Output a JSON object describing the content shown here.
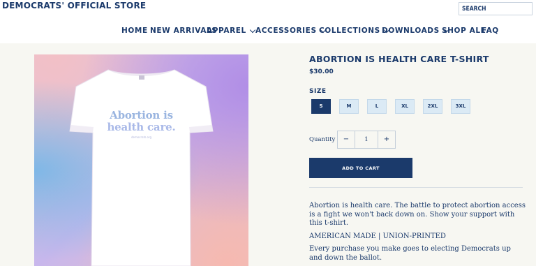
{
  "header": {
    "store_title": "DEMOCRATS' OFFICIAL STORE",
    "search_placeholder": "SEARCH"
  },
  "nav": {
    "items": [
      {
        "label": "HOME",
        "has_dropdown": false
      },
      {
        "label": "NEW ARRIVALS",
        "has_dropdown": false
      },
      {
        "label": "APPAREL",
        "has_dropdown": true
      },
      {
        "label": "ACCESSORIES",
        "has_dropdown": true
      },
      {
        "label": "COLLECTIONS",
        "has_dropdown": true
      },
      {
        "label": "DOWNLOADS",
        "has_dropdown": true
      },
      {
        "label": "SHOP ALL",
        "has_dropdown": false
      },
      {
        "label": "FAQ",
        "has_dropdown": false
      }
    ]
  },
  "product": {
    "image": {
      "shirt_line1": "Abortion is",
      "shirt_line2": "health care.",
      "shirt_url": "democrats.org"
    },
    "title": "ABORTION IS HEALTH CARE T-SHIRT",
    "price": "$30.00",
    "size_label": "SIZE",
    "sizes": [
      "S",
      "M",
      "L",
      "XL",
      "2XL",
      "3XL"
    ],
    "selected_size": "S",
    "quantity_label": "Quantity",
    "quantity_minus": "−",
    "quantity_plus": "+",
    "quantity_value": "1",
    "add_to_cart_label": "ADD TO CART",
    "description": [
      "Abortion is health care. The battle to protect abortion access is a fight we won't back down on. Show your support with this t-shirt.",
      "AMERICAN MADE | UNION-PRINTED",
      "Every purchase you make goes to electing Democrats up and down the ballot."
    ]
  },
  "colors": {
    "brand_navy": "#1b3a6b",
    "page_bg": "#f7f7f2",
    "size_chip_bg": "#dbeaf5"
  }
}
